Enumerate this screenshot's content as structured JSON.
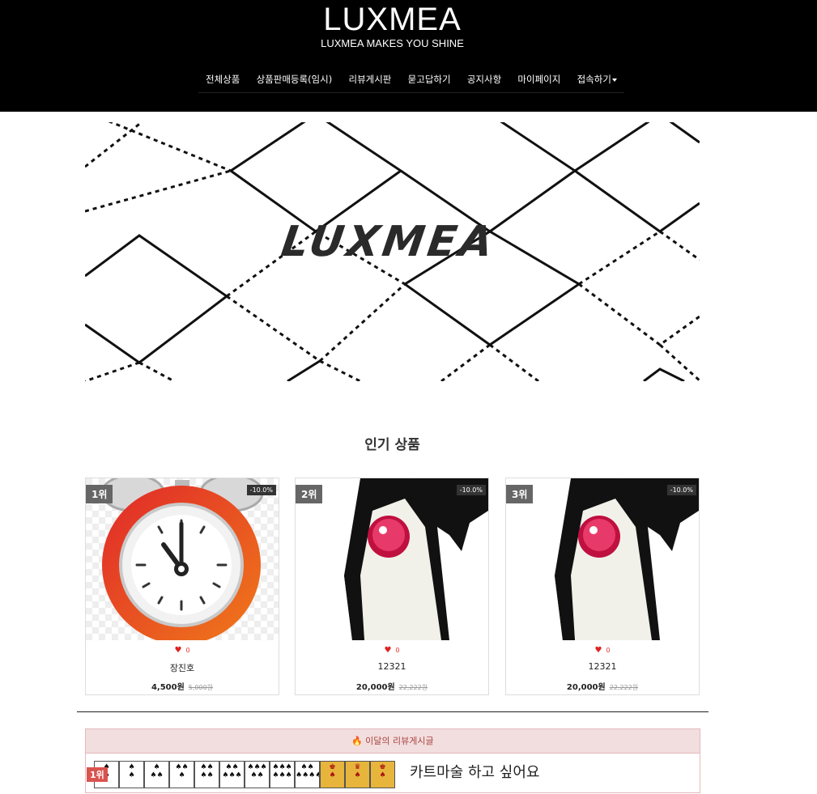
{
  "header": {
    "title": "LUXMEA",
    "subtitle": "LUXMEA MAKES YOU SHINE",
    "nav": [
      "전체상품",
      "상품판매등록(임시)",
      "리뷰게시판",
      "묻고답하기",
      "공지사항",
      "마이페이지",
      "접속하기"
    ]
  },
  "banner": {
    "logo_text": "LUXMEA"
  },
  "popular": {
    "title": "인기 상품",
    "products": [
      {
        "rank": "1위",
        "discount": "-10.0%",
        "likes": "0",
        "name": "장진호",
        "price": "4,500원",
        "original_price": "5,000원",
        "image": "alarm-clock"
      },
      {
        "rank": "2위",
        "discount": "-10.0%",
        "likes": "0",
        "name": "12321",
        "price": "20,000원",
        "original_price": "22,222원",
        "image": "duke-mascot"
      },
      {
        "rank": "3위",
        "discount": "-10.0%",
        "likes": "0",
        "name": "12321",
        "price": "20,000원",
        "original_price": "22,222원",
        "image": "duke-mascot"
      }
    ]
  },
  "reviews": {
    "header": "이달의 리뷰게시글",
    "items": [
      {
        "rank": "1위",
        "title": "카트마술 하고 싶어요"
      }
    ]
  },
  "colors": {
    "header_bg": "#000000",
    "badge": "#666666",
    "heart": "#dd2222",
    "review_header_bg": "#f2dede",
    "review_header_text": "#a94442"
  }
}
